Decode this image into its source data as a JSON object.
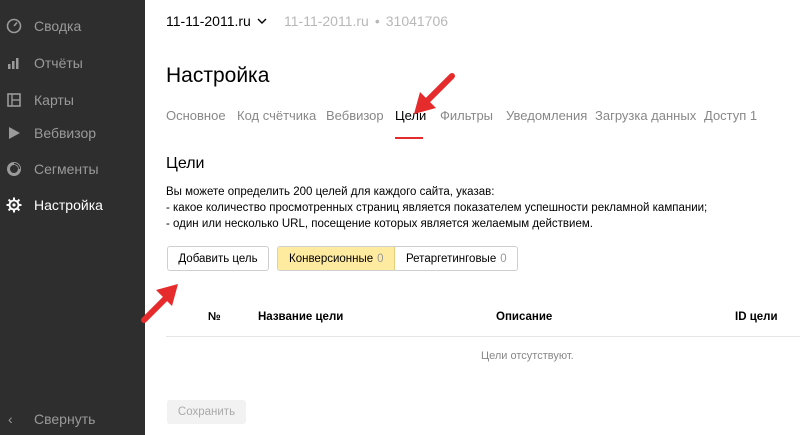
{
  "sidebar": {
    "items": [
      {
        "label": "Сводка",
        "icon": "dashboard-icon"
      },
      {
        "label": "Отчёты",
        "icon": "bar-chart-icon"
      },
      {
        "label": "Карты",
        "icon": "map-icon"
      },
      {
        "label": "Вебвизор",
        "icon": "play-icon"
      },
      {
        "label": "Сегменты",
        "icon": "segments-icon"
      },
      {
        "label": "Настройка",
        "icon": "gear-icon",
        "active": true
      }
    ],
    "collapse_label": "Свернуть",
    "collapse_icon": "‹"
  },
  "header": {
    "counter_name": "11-11-2011.ru",
    "site": "11-11-2011.ru",
    "separator": "•",
    "counter_id": "31041706"
  },
  "page_title": "Настройка",
  "tabs": [
    {
      "label": "Основное"
    },
    {
      "label": "Код счётчика"
    },
    {
      "label": "Вебвизор"
    },
    {
      "label": "Цели",
      "active": true
    },
    {
      "label": "Фильтры"
    },
    {
      "label": "Уведомления"
    },
    {
      "label": "Загрузка данных"
    },
    {
      "label": "Доступ 1"
    }
  ],
  "goals": {
    "title": "Цели",
    "description": [
      "Вы можете определить 200 целей для каждого сайта, указав:",
      "- какое количество просмотренных страниц является показателем успешности рекламной кампании;",
      "- один или несколько URL, посещение которых является желаемым действием."
    ],
    "add_button": "Добавить цель",
    "filters": [
      {
        "label": "Конверсионные",
        "count": "0",
        "active": true
      },
      {
        "label": "Ретаргетинговые",
        "count": "0"
      }
    ],
    "table_headers": [
      "№",
      "Название цели",
      "Описание",
      "ID цели"
    ],
    "empty_text": "Цели отсутствуют.",
    "save_button": "Сохранить"
  },
  "colors": {
    "sidebar_bg": "#2e2e2e",
    "accent_red": "#e52b2b",
    "active_filter_bg": "#ffeba0"
  }
}
